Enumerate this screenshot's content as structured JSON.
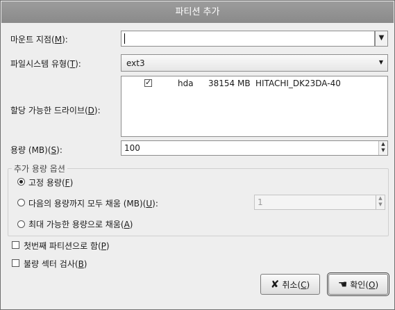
{
  "window": {
    "title": "파티션 추가"
  },
  "mount_point": {
    "label": "마운트 지점(",
    "mnemonic": "M",
    "label_end": "):",
    "value": ""
  },
  "fs_type": {
    "label": "파일시스템 유형(",
    "mnemonic": "T",
    "label_end": "):",
    "value": "ext3"
  },
  "drives": {
    "label": "할당 가능한 드라이브(",
    "mnemonic": "D",
    "label_end": "):",
    "rows": [
      {
        "checked": true,
        "check": "✓",
        "name": "hda",
        "size": "38154 MB",
        "model": "HITACHI_DK23DA-40"
      }
    ]
  },
  "size": {
    "label": "용량 (MB)(",
    "mnemonic": "S",
    "label_end": "):",
    "value": "100"
  },
  "options": {
    "title": "추가 용량 옵션",
    "fixed": {
      "label": "고정 용량(",
      "mnemonic": "F",
      "label_end": ")",
      "selected": true
    },
    "fill_upto": {
      "label": "다음의 용량까지 모두 채움 (MB)(",
      "mnemonic": "U",
      "label_end": "):",
      "selected": false,
      "value": "1"
    },
    "fill_max": {
      "label": "최대 가능한 용량으로 채움(",
      "mnemonic": "A",
      "label_end": ")",
      "selected": false
    }
  },
  "primary": {
    "label": "첫번째 파티션으로 함(",
    "mnemonic": "P",
    "label_end": ")",
    "checked": false
  },
  "badblocks": {
    "label": "불량 섹터 검사(",
    "mnemonic": "B",
    "label_end": ")",
    "checked": false
  },
  "buttons": {
    "cancel": {
      "icon": "✘",
      "label": "취소(",
      "mnemonic": "C",
      "label_end": ")"
    },
    "ok": {
      "icon": "☚",
      "label": "확인(",
      "mnemonic": "O",
      "label_end": ")"
    }
  },
  "icons": {
    "combo_arrow": "▼",
    "spin_up": "▲",
    "spin_down": "▼"
  },
  "colors": {
    "titlebar": "#929292",
    "dialog_bg": "#eeeeee"
  }
}
